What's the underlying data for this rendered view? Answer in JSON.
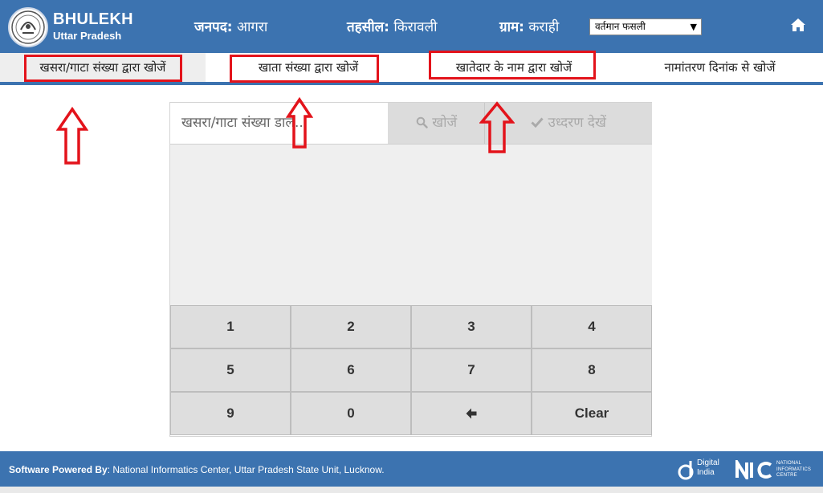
{
  "header": {
    "brand_title": "BHULEKH",
    "brand_subtitle": "Uttar Pradesh",
    "district_label": "जनपद:",
    "district_value": "आगरा",
    "tehsil_label": "तहसील:",
    "tehsil_value": "किरावली",
    "village_label": "ग्राम:",
    "village_value": "कराही",
    "season_select": "वर्तमान फसली",
    "home_icon": "home-icon"
  },
  "tabs": [
    {
      "label": "खसरा/गाटा संख्या द्वारा खोजें",
      "active": true
    },
    {
      "label": "खाता संख्या द्वारा खोजें",
      "active": false
    },
    {
      "label": "खातेदार के नाम द्वारा खोजें",
      "active": false
    },
    {
      "label": "नामांतरण दिनांक से खोजें",
      "active": false
    }
  ],
  "search": {
    "placeholder": "खसरा/गाटा संख्या डालें...",
    "search_button": "खोजें",
    "search_icon": "search-icon",
    "view_button": "उध्दरण देखें",
    "view_icon": "check-icon"
  },
  "keypad": {
    "keys": [
      "1",
      "2",
      "3",
      "4",
      "5",
      "6",
      "7",
      "8",
      "9",
      "0",
      "",
      "Clear"
    ],
    "backspace_icon": "backspace-arrow-icon"
  },
  "footer": {
    "label": "Software Powered By",
    "text": ": National Informatics Center, Uttar Pradesh State Unit, Lucknow.",
    "digital_india_line1": "Digital",
    "digital_india_line2": "India",
    "nic_line1": "NATIONAL",
    "nic_line2": "INFORMATICS",
    "nic_line3": "CENTRE"
  },
  "colors": {
    "header_blue": "#3c73b0",
    "annotation_red": "#e3131b"
  }
}
